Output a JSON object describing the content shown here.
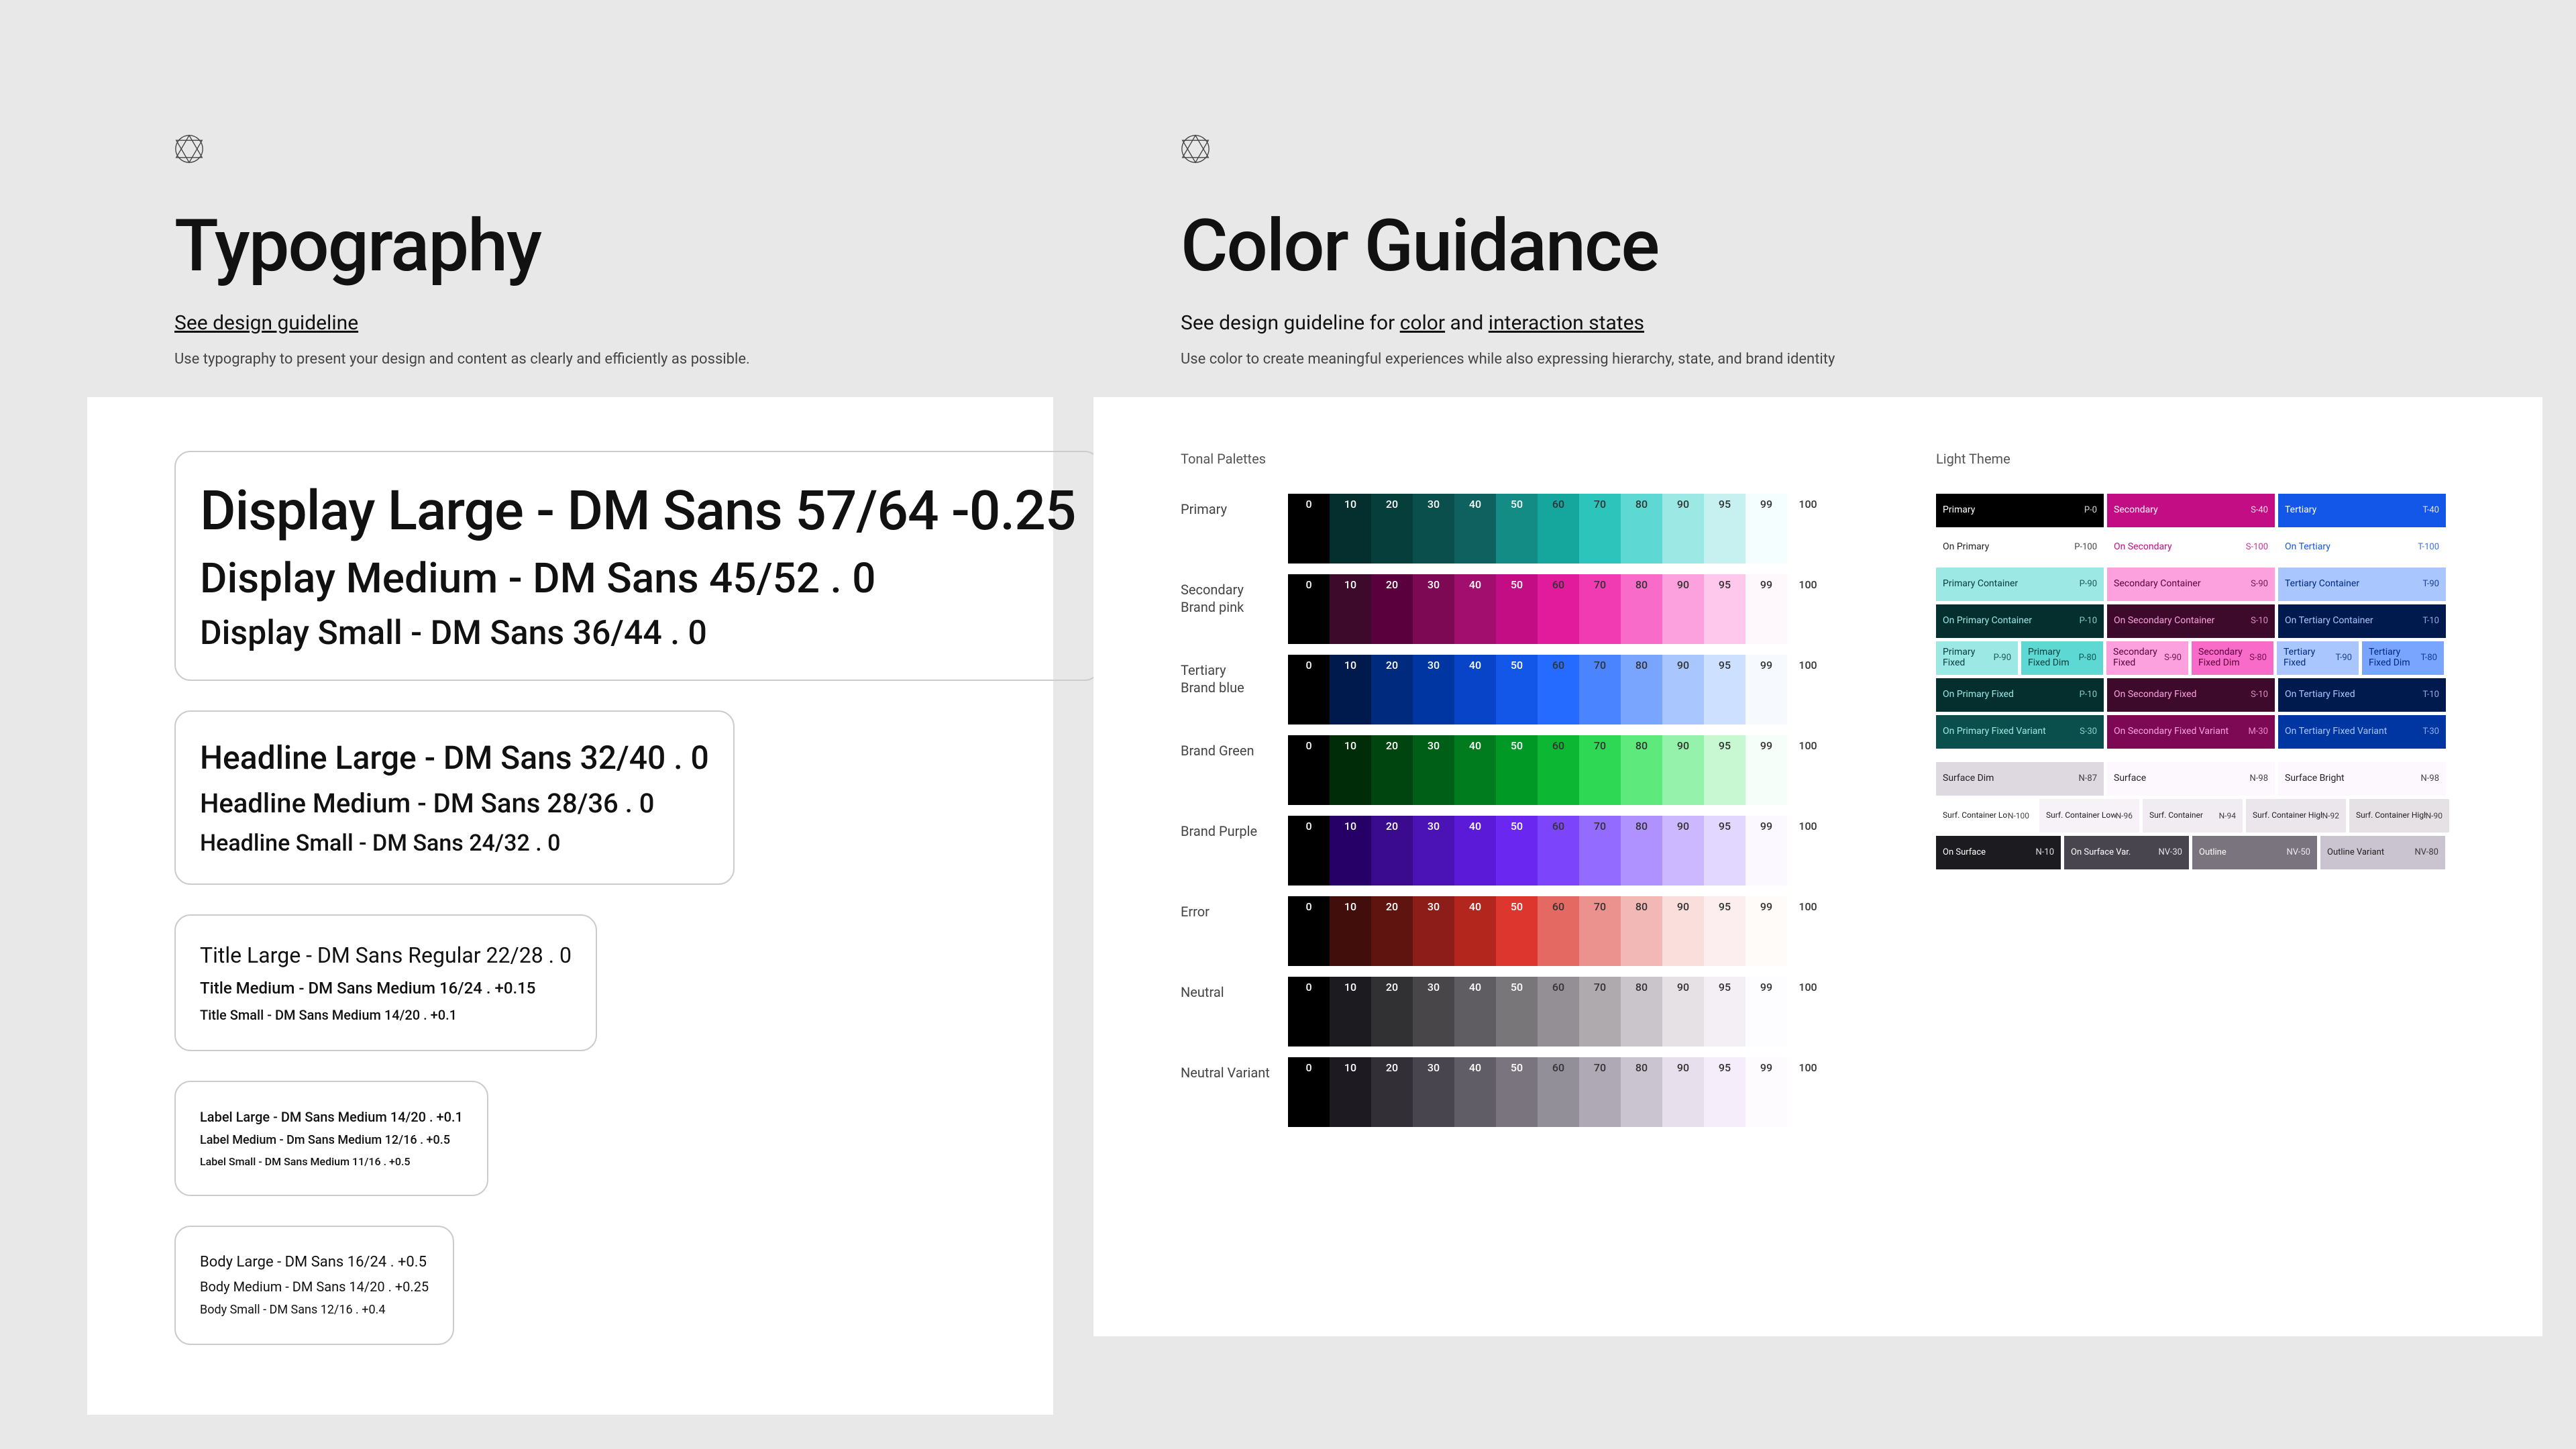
{
  "typography": {
    "title": "Typography",
    "guideline_link": "See design guideline",
    "sub": "Use typography to present your design and content as clearly and efficiently as possible.",
    "display_large": "Display Large - DM Sans 57/64 -0.25",
    "display_medium": "Display Medium - DM Sans 45/52 .  0",
    "display_small": "Display Small - DM Sans 36/44 . 0",
    "headline_large": "Headline Large - DM Sans 32/40 . 0",
    "headline_medium": "Headline Medium - DM Sans 28/36 . 0",
    "headline_small": "Headline Small - DM Sans 24/32 . 0",
    "title_large": "Title Large - DM Sans Regular 22/28 . 0",
    "title_medium": "Title Medium - DM Sans Medium 16/24 . +0.15",
    "title_small": "Title Small - DM Sans Medium 14/20 . +0.1",
    "label_large": "Label Large - DM Sans Medium 14/20 . +0.1",
    "label_medium": "Label Medium - Dm Sans Medium 12/16 .  +0.5",
    "label_small": "Label Small - DM Sans Medium 11/16 . +0.5",
    "body_large": "Body Large - DM Sans 16/24 . +0.5",
    "body_medium": "Body Medium - DM Sans 14/20 . +0.25",
    "body_small": "Body Small - DM Sans 12/16 . +0.4"
  },
  "color": {
    "title": "Color Guidance",
    "sub_prefix": "See design guideline for ",
    "link_color": "color",
    "sub_and": " and ",
    "link_states": "interaction states",
    "sub2": "Use color to create meaningful experiences while also expressing hierarchy, state, and brand identity",
    "tonal_label": "Tonal Palettes",
    "theme_label": "Light Theme",
    "steps": [
      "0",
      "10",
      "20",
      "30",
      "40",
      "50",
      "60",
      "70",
      "80",
      "90",
      "95",
      "99",
      "100"
    ],
    "palettes": [
      {
        "name": "Primary",
        "colors": [
          "#000000",
          "#042f2e",
          "#063e3c",
          "#0a4f4c",
          "#0e615e",
          "#128c84",
          "#15a79e",
          "#2dc5bb",
          "#5dd8d2",
          "#9be8e5",
          "#c7f1f0",
          "#f5fefe",
          "#ffffff"
        ]
      },
      {
        "name": "Secondary\nBrand pink",
        "colors": [
          "#000000",
          "#3d0a2b",
          "#5a003c",
          "#7d0854",
          "#a20e6d",
          "#c30d84",
          "#e21b9d",
          "#f03bb3",
          "#f86bc8",
          "#fca1de",
          "#fdc8ec",
          "#fef7fb",
          "#ffffff"
        ]
      },
      {
        "name": "Tertiary\nBrand blue",
        "colors": [
          "#000000",
          "#001a4d",
          "#002a7e",
          "#0036a2",
          "#0844c7",
          "#1357e8",
          "#256bff",
          "#4a85ff",
          "#7aa5ff",
          "#aac6ff",
          "#cde0ff",
          "#f6faff",
          "#ffffff"
        ]
      },
      {
        "name": "Brand Green",
        "colors": [
          "#000000",
          "#002c07",
          "#00450f",
          "#005f16",
          "#007b1d",
          "#009926",
          "#0cb833",
          "#2fd854",
          "#5ee97c",
          "#95f2aa",
          "#c7f8d1",
          "#f5fef8",
          "#ffffff"
        ]
      },
      {
        "name": "Brand Purple",
        "colors": [
          "#000000",
          "#260066",
          "#3a0a8f",
          "#4b12b6",
          "#5b1ad8",
          "#6a27f0",
          "#7d45fb",
          "#946bff",
          "#af92ff",
          "#cbb8ff",
          "#e2d8ff",
          "#fbf8ff",
          "#ffffff"
        ]
      },
      {
        "name": "Error",
        "colors": [
          "#000000",
          "#410e0b",
          "#601410",
          "#8c1d18",
          "#b3261e",
          "#dc362e",
          "#e46962",
          "#ec928e",
          "#f2b8b5",
          "#f9dedc",
          "#fceeee",
          "#fffbf9",
          "#ffffff"
        ]
      },
      {
        "name": "Neutral",
        "colors": [
          "#000000",
          "#1c1b1f",
          "#313033",
          "#484649",
          "#605d62",
          "#79767a",
          "#938f94",
          "#aeaaae",
          "#c9c5ca",
          "#e6e1e5",
          "#f4eff4",
          "#fdfcfe",
          "#ffffff"
        ]
      },
      {
        "name": "Neutral Variant",
        "colors": [
          "#000000",
          "#1d1a22",
          "#322f37",
          "#49454f",
          "#605d66",
          "#79747e",
          "#938f99",
          "#aea9b4",
          "#cac4d0",
          "#e7e0ec",
          "#f5eefa",
          "#fefbff",
          "#ffffff"
        ]
      }
    ],
    "theme_rows": [
      [
        {
          "label": "Primary",
          "code": "P-0",
          "bg": "#000000",
          "fg": "#ffffff"
        },
        {
          "label": "Secondary",
          "code": "S-40",
          "bg": "#c30d84",
          "fg": "#ffffff"
        },
        {
          "label": "Tertiary",
          "code": "T-40",
          "bg": "#1357e8",
          "fg": "#ffffff"
        }
      ],
      [
        {
          "label": "On Primary",
          "code": "P-100",
          "bg": "#ffffff",
          "fg": "#222222"
        },
        {
          "label": "On Secondary",
          "code": "S-100",
          "bg": "#ffffff",
          "fg": "#c30d84"
        },
        {
          "label": "On Tertiary",
          "code": "T-100",
          "bg": "#ffffff",
          "fg": "#1357e8"
        }
      ],
      [
        {
          "label": "Primary Container",
          "code": "P-90",
          "bg": "#9be8e5",
          "fg": "#063e3c"
        },
        {
          "label": "Secondary Container",
          "code": "S-90",
          "bg": "#fca1de",
          "fg": "#5a003c"
        },
        {
          "label": "Tertiary Container",
          "code": "T-90",
          "bg": "#aac6ff",
          "fg": "#002a7e"
        }
      ],
      [
        {
          "label": "On Primary Container",
          "code": "P-10",
          "bg": "#042f2e",
          "fg": "#9be8e5"
        },
        {
          "label": "On Secondary Container",
          "code": "S-10",
          "bg": "#3d0a2b",
          "fg": "#fca1de"
        },
        {
          "label": "On Tertiary Container",
          "code": "T-10",
          "bg": "#001a4d",
          "fg": "#aac6ff"
        }
      ],
      [
        {
          "label": "Primary Fixed",
          "code": "P-90",
          "bg": "#9be8e5",
          "fg": "#063e3c",
          "half": true
        },
        {
          "label": "Primary Fixed Dim",
          "code": "P-80",
          "bg": "#5dd8d2",
          "fg": "#063e3c",
          "half": true
        },
        {
          "label": "Secondary Fixed",
          "code": "S-90",
          "bg": "#fca1de",
          "fg": "#5a003c",
          "half": true
        },
        {
          "label": "Secondary Fixed Dim",
          "code": "S-80",
          "bg": "#f86bc8",
          "fg": "#5a003c",
          "half": true
        },
        {
          "label": "Tertiary Fixed",
          "code": "T-90",
          "bg": "#aac6ff",
          "fg": "#002a7e",
          "half": true
        },
        {
          "label": "Tertiary Fixed Dim",
          "code": "T-80",
          "bg": "#7aa5ff",
          "fg": "#002a7e",
          "half": true
        }
      ],
      [
        {
          "label": "On Primary Fixed",
          "code": "P-10",
          "bg": "#042f2e",
          "fg": "#9be8e5"
        },
        {
          "label": "On Secondary Fixed",
          "code": "S-10",
          "bg": "#3d0a2b",
          "fg": "#fca1de"
        },
        {
          "label": "On Tertiary Fixed",
          "code": "T-10",
          "bg": "#001a4d",
          "fg": "#aac6ff"
        }
      ],
      [
        {
          "label": "On Primary Fixed Variant",
          "code": "S-30",
          "bg": "#0a4f4c",
          "fg": "#9be8e5"
        },
        {
          "label": "On Secondary Fixed Variant",
          "code": "M-30",
          "bg": "#7d0854",
          "fg": "#fca1de"
        },
        {
          "label": "On Tertiary Fixed Variant",
          "code": "T-30",
          "bg": "#0036a2",
          "fg": "#aac6ff"
        }
      ]
    ],
    "surface_rows": {
      "a": [
        {
          "label": "Surface Dim",
          "code": "N-87",
          "bg": "#ded8e1",
          "fg": "#222"
        },
        {
          "label": "Surface",
          "code": "N-98",
          "bg": "#fdf8fd",
          "fg": "#222"
        },
        {
          "label": "Surface Bright",
          "code": "N-98",
          "bg": "#fdf8fd",
          "fg": "#222"
        }
      ],
      "b": [
        {
          "label": "Surf. Container Lowest",
          "code": "N-100",
          "bg": "#ffffff",
          "fg": "#222"
        },
        {
          "label": "Surf. Container Low",
          "code": "N-96",
          "bg": "#f7f2f7",
          "fg": "#222"
        },
        {
          "label": "Surf. Container",
          "code": "N-94",
          "bg": "#f1ecf1",
          "fg": "#222"
        },
        {
          "label": "Surf. Container High",
          "code": "N-92",
          "bg": "#ebe6eb",
          "fg": "#222"
        },
        {
          "label": "Surf. Container Highest",
          "code": "N-90",
          "bg": "#e6e1e5",
          "fg": "#222"
        }
      ],
      "c": [
        {
          "label": "On Surface",
          "code": "N-10",
          "bg": "#1c1b1f",
          "fg": "#fff"
        },
        {
          "label": "On Surface Var.",
          "code": "NV-30",
          "bg": "#49454f",
          "fg": "#fff"
        },
        {
          "label": "Outline",
          "code": "NV-50",
          "bg": "#79747e",
          "fg": "#fff"
        },
        {
          "label": "Outline Variant",
          "code": "NV-80",
          "bg": "#cac4d0",
          "fg": "#222"
        }
      ]
    }
  }
}
